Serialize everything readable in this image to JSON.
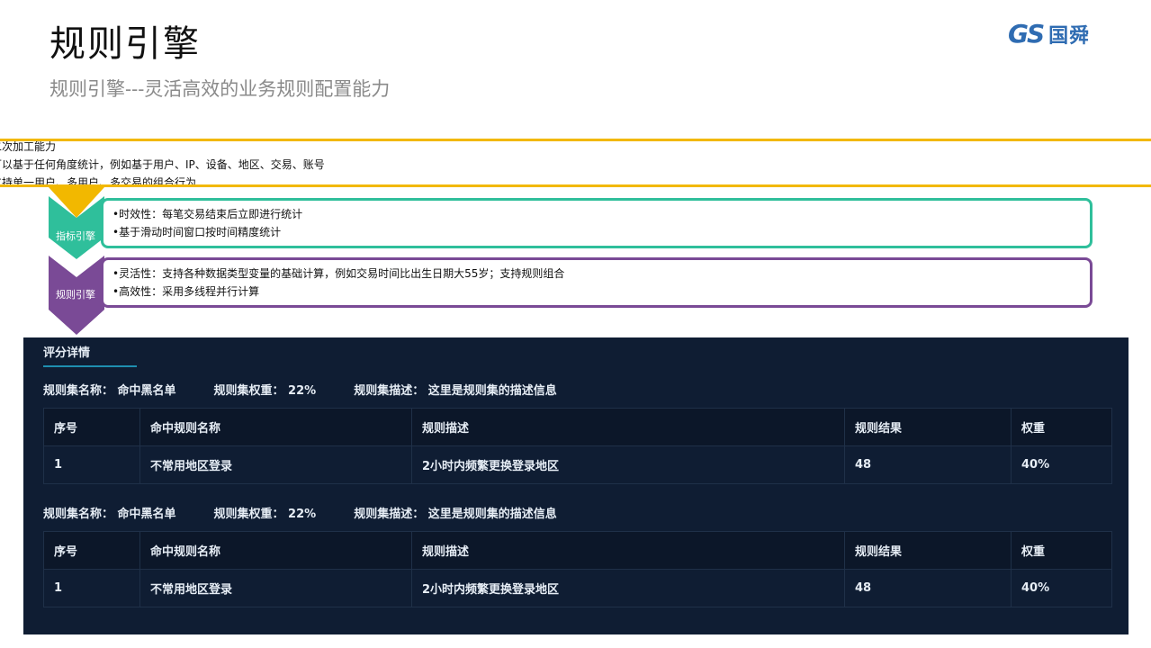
{
  "header": {
    "title": "规则引擎",
    "subtitle": "规则引擎---灵活高效的业务规则配置能力",
    "logo_text_gs": "GS",
    "logo_text_cn": "国舜"
  },
  "band": {
    "lines": [
      "二次加工能力",
      "可以基于任何角度统计，例如基于用户、IP、设备、地区、交易、账号",
      "支持单一用户、多用户、多交易的组合行为"
    ],
    "color": "#f2b800"
  },
  "sections": [
    {
      "label": "指标引擎",
      "color": "#2fbf9b",
      "lines": [
        "•时效性：每笔交易结束后立即进行统计",
        "•基于滑动时间窗口按时间精度统计"
      ]
    },
    {
      "label": "规则引擎",
      "color": "#7a4a96",
      "lines": [
        "•灵活性：支持各种数据类型变量的基础计算，例如交易时间比出生日期大55岁；支持规则组合",
        "•高效性：采用多线程并行计算"
      ]
    }
  ],
  "panel": {
    "tab": "评分详情",
    "rule_sets": [
      {
        "name": "规则集名称： 命中黑名单",
        "weight": "规则集权重： 22%",
        "desc": "规则集描述： 这里是规则集的描述信息",
        "columns": [
          "序号",
          "命中规则名称",
          "规则描述",
          "规则结果",
          "权重"
        ],
        "rows": [
          [
            "1",
            "不常用地区登录",
            "2小时内频繁更换登录地区",
            "48",
            "40%"
          ]
        ]
      },
      {
        "name": "规则集名称： 命中黑名单",
        "weight": "规则集权重： 22%",
        "desc": "规则集描述： 这里是规则集的描述信息",
        "columns": [
          "序号",
          "命中规则名称",
          "规则描述",
          "规则结果",
          "权重"
        ],
        "rows": [
          [
            "1",
            "不常用地区登录",
            "2小时内频繁更换登录地区",
            "48",
            "40%"
          ]
        ]
      }
    ]
  }
}
